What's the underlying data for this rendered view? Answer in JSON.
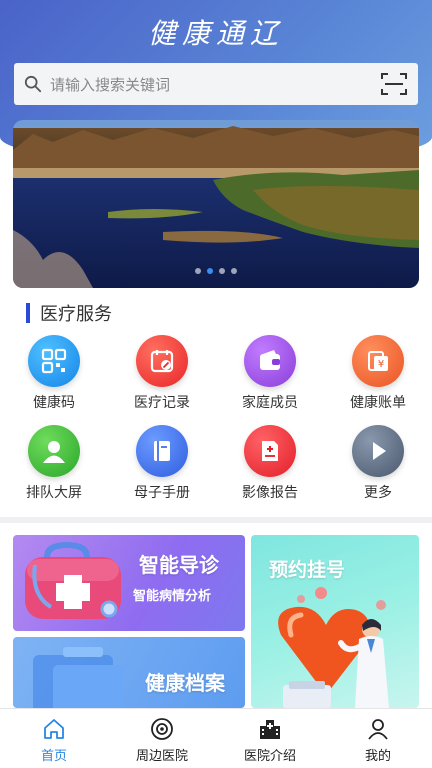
{
  "header": {
    "title": "健康通辽"
  },
  "search": {
    "placeholder": "请输入搜索关键词"
  },
  "banner": {
    "dots": 4,
    "active_dot": 2
  },
  "section": {
    "title": "医疗服务"
  },
  "services": [
    {
      "label": "健康码",
      "icon": "qr-code-icon",
      "color": "#1e9af0"
    },
    {
      "label": "医疗记录",
      "icon": "calendar-record-icon",
      "color": "#f0453a"
    },
    {
      "label": "家庭成员",
      "icon": "wallet-icon",
      "color": "#9c4fe0"
    },
    {
      "label": "健康账单",
      "icon": "bill-icon",
      "color": "#f2673a"
    },
    {
      "label": "排队大屏",
      "icon": "user-icon",
      "color": "#3cba3c"
    },
    {
      "label": "母子手册",
      "icon": "book-icon",
      "color": "#3a6ee8"
    },
    {
      "label": "影像报告",
      "icon": "report-icon",
      "color": "#f0353a"
    },
    {
      "label": "更多",
      "icon": "play-icon",
      "color": "#5b6a80"
    }
  ],
  "cards": {
    "smart_guide": {
      "title": "智能导诊",
      "subtitle": "智能病情分析"
    },
    "appointment": {
      "title": "预约挂号"
    },
    "health_record": {
      "title": "健康档案"
    }
  },
  "tabs": [
    {
      "label": "首页",
      "icon": "home-icon",
      "active": true
    },
    {
      "label": "周边医院",
      "icon": "location-icon",
      "active": false
    },
    {
      "label": "医院介绍",
      "icon": "hospital-icon",
      "active": false
    },
    {
      "label": "我的",
      "icon": "profile-icon",
      "active": false
    }
  ],
  "colors": {
    "header_start": "#4a63c9",
    "header_end": "#6d9fe0",
    "accent": "#2b4ad8",
    "tab_active": "#2a86e0"
  }
}
